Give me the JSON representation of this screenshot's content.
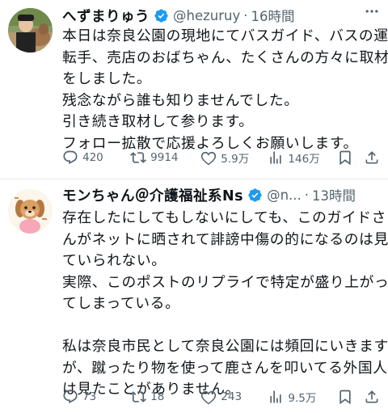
{
  "tweets": [
    {
      "name": "へずまりゅう",
      "handle": "@hezuruy",
      "separator": "·",
      "time": "16時間",
      "lines": [
        "本日は奈良公園の現地にてバスガイド、バスの運",
        "転手、売店のおばちゃん、たくさんの方々に取材",
        "をしました。",
        "残念ながら誰も知りませんでした。",
        "引き続き取材して参ります。",
        "フォロー拡散で応援よろしくお願いします。"
      ],
      "actions": {
        "replies": "420",
        "reposts": "9914",
        "likes": "5.9万",
        "views": "146万"
      }
    },
    {
      "name": "モンちゃん＠介護福祉系Ns",
      "handle": "@n...",
      "separator": "·",
      "time": "13時間",
      "lines": [
        "存在したにしてもしないにしても、このガイドさ",
        "んがネットに晒されて誹謗中傷の的になるのは見",
        "ていられない。",
        "実際、このポストのリプライで特定が盛り上がっ",
        "てしまっている。",
        "",
        "私は奈良市民として奈良公園には頻回にいきます",
        "が、蹴ったり物を使って鹿さんを叩いてる外国人",
        "は見たことがありません。"
      ],
      "actions": {
        "replies": "73",
        "reposts": "18",
        "likes": "243",
        "views": "9.5万"
      }
    }
  ],
  "icons": [
    "verified-badge-icon",
    "more-icon",
    "reply-icon",
    "repost-icon",
    "like-icon",
    "views-icon",
    "bookmark-icon",
    "share-icon"
  ],
  "colors": {
    "verified": "#1d9bf0",
    "text": "#0f1419",
    "secondary": "#536471",
    "divider": "#e6e9eb"
  }
}
